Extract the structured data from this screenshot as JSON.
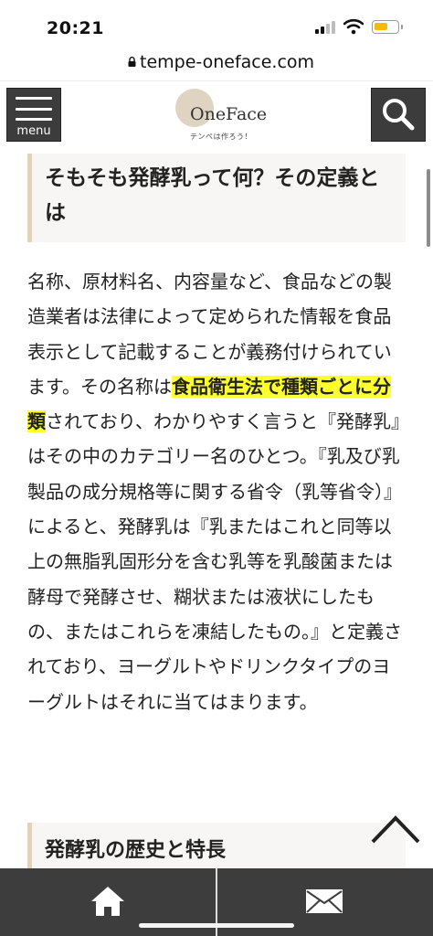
{
  "status_bar": {
    "time": "20:21"
  },
  "browser": {
    "url": "tempe-oneface.com"
  },
  "header": {
    "menu_label": "menu",
    "logo_text": "OneFace",
    "logo_tagline": "テンペは作ろう！"
  },
  "article": {
    "heading1": "そもそも発酵乳って何？その定義とは",
    "paragraph": {
      "part1": "名称、原材料名、内容量など、食品などの製造業者は法律によって定められた情報を食品表示として記載することが義務付けられています。その名称は",
      "highlight": "食品衛生法で種類ごとに分類",
      "part2": "されており、わかりやすく言うと『発酵乳』はその中のカテゴリー名のひとつ。『乳及び乳製品の成分規格等に関する省令（乳等省令）』によると、発酵乳は『乳またはこれと同等以上の無脂乳固形分を含む乳等を乳酸菌または酵母で発酵させ、糊状または液状にしたもの、またはこれらを凍結したもの。』と定義されており、ヨーグルトやドリンクタイプのヨーグルトはそれに当てはまります。"
    },
    "heading2": "発酵乳の歴史と特長"
  },
  "colors": {
    "highlight": "#ffff2e",
    "heading_border": "#dfd3bd",
    "bar_bg": "#3d3d3d"
  },
  "icons": [
    "menu-icon",
    "search-icon",
    "back-to-top-icon",
    "home-icon",
    "mail-icon",
    "lock-icon"
  ]
}
